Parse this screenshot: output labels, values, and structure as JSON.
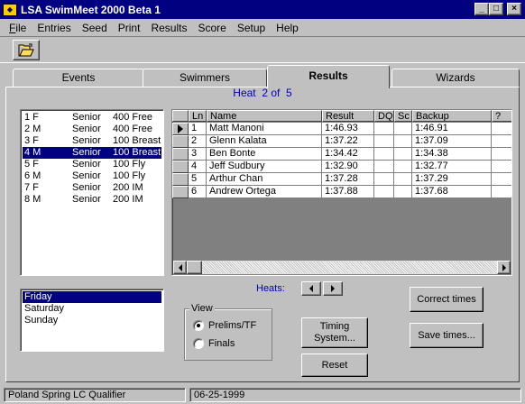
{
  "window": {
    "title": "LSA SwimMeet 2000 Beta 1"
  },
  "menu": [
    {
      "label": "File",
      "u": "F",
      "rest": "ile"
    },
    {
      "label": "Entries",
      "u": "",
      "rest": "Entries"
    },
    {
      "label": "Seed",
      "u": "",
      "rest": "Seed"
    },
    {
      "label": "Print",
      "u": "",
      "rest": "Print"
    },
    {
      "label": "Results",
      "u": "",
      "rest": "Results"
    },
    {
      "label": "Score",
      "u": "",
      "rest": "Score"
    },
    {
      "label": "Setup",
      "u": "",
      "rest": "Setup"
    },
    {
      "label": "Help",
      "u": "",
      "rest": "Help"
    }
  ],
  "tabs": [
    {
      "label": "Events",
      "active": false
    },
    {
      "label": "Swimmers",
      "active": false
    },
    {
      "label": "Results",
      "active": true
    },
    {
      "label": "Wizards",
      "active": false
    }
  ],
  "heat": {
    "prefix": "Heat",
    "current": "2",
    "of": "of",
    "total": "5"
  },
  "events": [
    {
      "num": "1 F",
      "age": "Senior",
      "event": "400 Free",
      "selected": false
    },
    {
      "num": "2 M",
      "age": "Senior",
      "event": "400 Free",
      "selected": false
    },
    {
      "num": "3 F",
      "age": "Senior",
      "event": "100 Breast",
      "selected": false
    },
    {
      "num": "4 M",
      "age": "Senior",
      "event": "100 Breast",
      "selected": true
    },
    {
      "num": "5 F",
      "age": "Senior",
      "event": "100 Fly",
      "selected": false
    },
    {
      "num": "6 M",
      "age": "Senior",
      "event": "100 Fly",
      "selected": false
    },
    {
      "num": "7 F",
      "age": "Senior",
      "event": "200 IM",
      "selected": false
    },
    {
      "num": "8 M",
      "age": "Senior",
      "event": "200 IM",
      "selected": false
    }
  ],
  "days": [
    {
      "label": "Friday",
      "selected": true
    },
    {
      "label": "Saturday",
      "selected": false
    },
    {
      "label": "Sunday",
      "selected": false
    }
  ],
  "results_table": {
    "columns": [
      "Ln",
      "Name",
      "Result",
      "DQ",
      "Sc",
      "Backup",
      "?"
    ],
    "rows": [
      {
        "ln": "1",
        "name": "Matt Manoni",
        "result": "1:46.93",
        "dq": "",
        "sc": "",
        "backup": "1:46.91",
        "current": true
      },
      {
        "ln": "2",
        "name": "Glenn Kalata",
        "result": "1:37.22",
        "dq": "",
        "sc": "",
        "backup": "1:37.09",
        "current": false
      },
      {
        "ln": "3",
        "name": "Ben Bonte",
        "result": "1:34.42",
        "dq": "",
        "sc": "",
        "backup": "1:34.38",
        "current": false
      },
      {
        "ln": "4",
        "name": "Jeff Sudbury",
        "result": "1:32.90",
        "dq": "",
        "sc": "",
        "backup": "1:32.77",
        "current": false
      },
      {
        "ln": "5",
        "name": "Arthur Chan",
        "result": "1:37.28",
        "dq": "",
        "sc": "",
        "backup": "1:37.29",
        "current": false
      },
      {
        "ln": "6",
        "name": "Andrew Ortega",
        "result": "1:37.88",
        "dq": "",
        "sc": "",
        "backup": "1:37.68",
        "current": false
      }
    ]
  },
  "heats_label": "Heats:",
  "view": {
    "legend": "View",
    "options": [
      {
        "label": "Prelims/TF",
        "checked": true
      },
      {
        "label": "Finals",
        "checked": false
      }
    ]
  },
  "buttons": {
    "timing": "Timing System...",
    "reset": "Reset",
    "correct": "Correct times",
    "save": "Save times..."
  },
  "status": {
    "meet_name": "Poland Spring LC Qualifier",
    "date": "06-25-1999"
  },
  "colors": {
    "titlebar": "#000080",
    "face": "#c0c0c0",
    "selection": "#000080",
    "label_blue": "#0000c0"
  }
}
